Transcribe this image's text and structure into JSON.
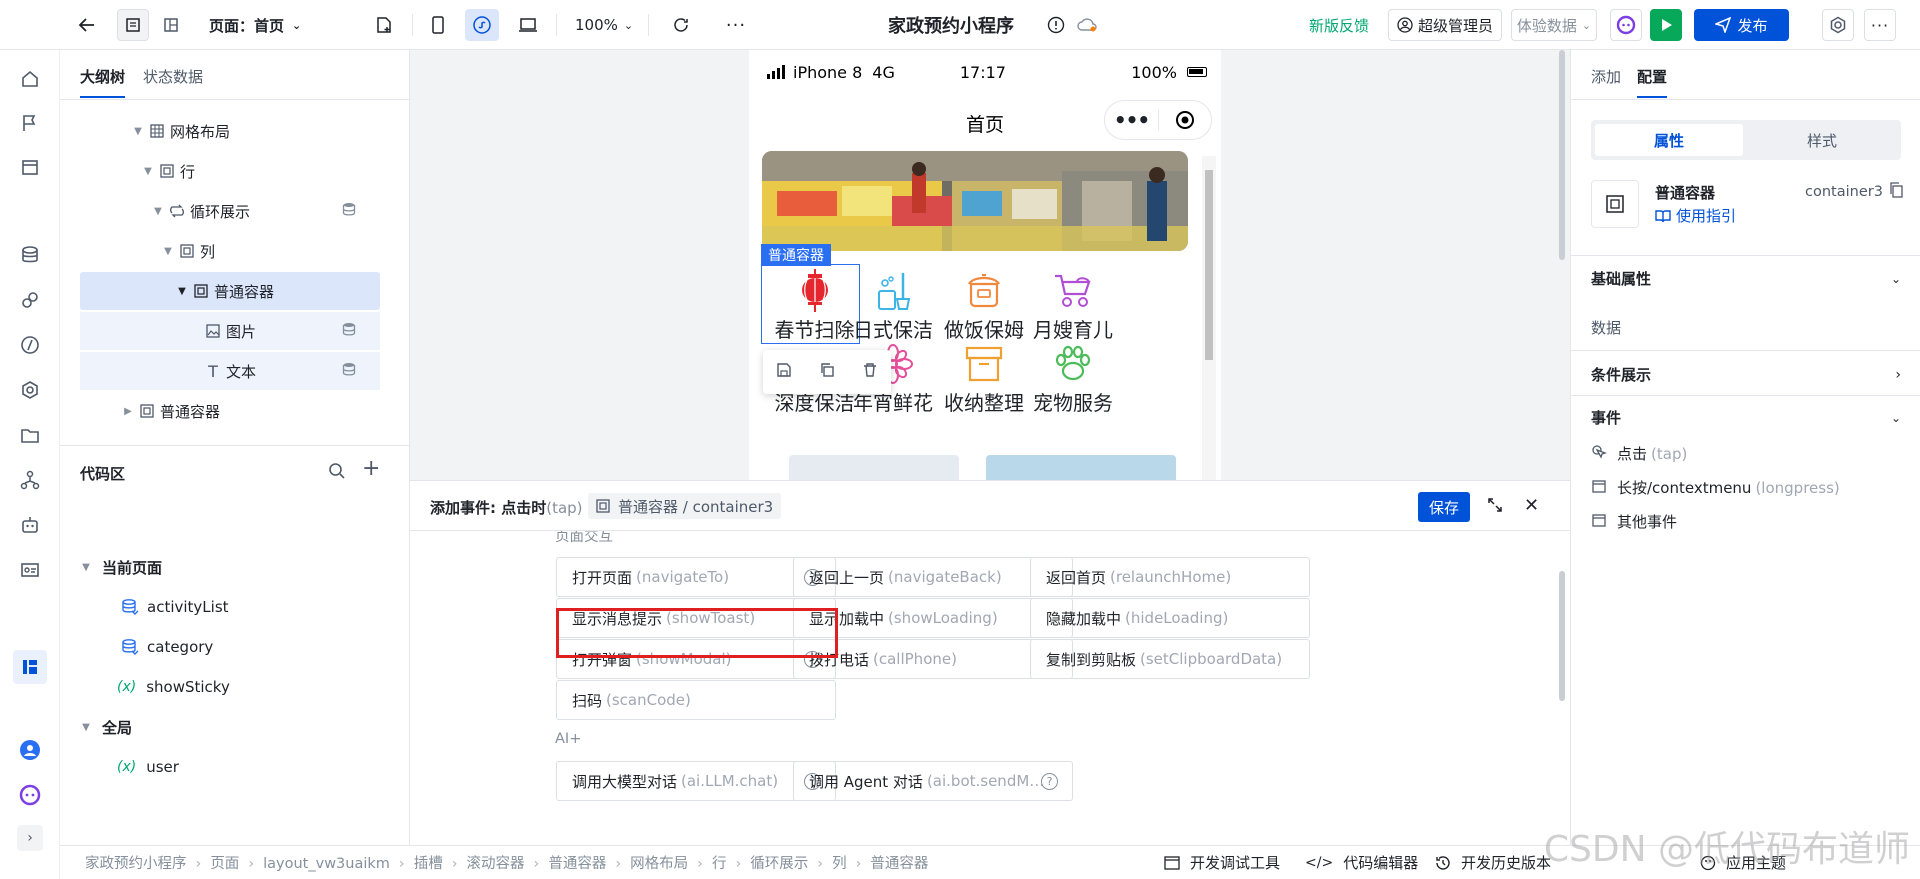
{
  "topbar": {
    "page_label": "页面：首页",
    "zoom": "100%",
    "app_title": "家政预约小程序",
    "feedback": "新版反馈",
    "admin": "超级管理员",
    "env_select": "体验数据",
    "publish": "发布"
  },
  "outline": {
    "tabs": [
      "大纲树",
      "状态数据"
    ],
    "tree": [
      {
        "label": "网格布局"
      },
      {
        "label": "行"
      },
      {
        "label": "循环展示"
      },
      {
        "label": "列"
      },
      {
        "label": "普通容器"
      },
      {
        "label": "图片"
      },
      {
        "label": "文本"
      },
      {
        "label": "普通容器"
      }
    ],
    "code_title": "代码区",
    "current_page": "当前页面",
    "vars": [
      "activityList",
      "category",
      "showSticky"
    ],
    "global": "全局",
    "global_vars": [
      "user"
    ],
    "var_prefix": "(x)"
  },
  "phone": {
    "device": "iPhone 8",
    "network": "4G",
    "time": "17:17",
    "battery": "100%",
    "nav_title": "首页",
    "selected_tag": "普通容器",
    "items": [
      {
        "label": "春节扫除",
        "icon": "lantern-icon",
        "color": "#e6262e"
      },
      {
        "label": "日式保洁",
        "icon": "cleaning-icon",
        "color": "#3cb4e6"
      },
      {
        "label": "做饭保姆",
        "icon": "rice-cooker-icon",
        "color": "#f0883e"
      },
      {
        "label": "月嫂育儿",
        "icon": "stroller-icon",
        "color": "#b04fd6"
      },
      {
        "label": "深度保洁",
        "icon": "deep-clean-icon",
        "color": "#3c8fe6"
      },
      {
        "label": "年宵鲜花",
        "icon": "flower-icon",
        "color": "#e64f9a"
      },
      {
        "label": "收纳整理",
        "icon": "box-icon",
        "color": "#f0a030"
      },
      {
        "label": "宠物服务",
        "icon": "paw-icon",
        "color": "#4cbb5a"
      }
    ]
  },
  "rpanel": {
    "tabs": [
      "添加",
      "配置"
    ],
    "seg": [
      "属性",
      "样式"
    ],
    "component_name": "普通容器",
    "component_id": "container3",
    "guide": "使用指引",
    "basic": "基础属性",
    "data_label": "数据",
    "cond": "条件展示",
    "events": "事件",
    "event_items": [
      {
        "label": "点击",
        "code": "(tap)"
      },
      {
        "label": "长按/contextmenu",
        "code": "(longpress)"
      },
      {
        "label": "其他事件",
        "code": ""
      }
    ]
  },
  "dialog": {
    "title": "添加事件: 点击时",
    "title_code": "(tap)",
    "path": "普通容器 / container3",
    "save": "保存",
    "section1": "页面交互",
    "section2": "AI+",
    "options": [
      {
        "label": "打开页面",
        "code": "(navigateTo)",
        "help": true
      },
      {
        "label": "返回上一页",
        "code": "(navigateBack)",
        "help": false
      },
      {
        "label": "返回首页",
        "code": "(relaunchHome)",
        "help": false
      },
      {
        "label": "显示消息提示",
        "code": "(showToast)",
        "help": false
      },
      {
        "label": "显示加载中",
        "code": "(showLoading)",
        "help": false
      },
      {
        "label": "隐藏加载中",
        "code": "(hideLoading)",
        "help": false
      },
      {
        "label": "打开弹窗",
        "code": "(showModal)",
        "help": true
      },
      {
        "label": "拨打电话",
        "code": "(callPhone)",
        "help": false
      },
      {
        "label": "复制到剪贴板",
        "code": "(setClipboardData)",
        "help": false
      },
      {
        "label": "扫码",
        "code": "(scanCode)",
        "help": false
      }
    ],
    "ai_options": [
      {
        "label": "调用大模型对话",
        "code": "(ai.LLM.chat)",
        "help": true
      },
      {
        "label": "调用 Agent 对话",
        "code": "(ai.bot.sendM…",
        "help": true
      }
    ]
  },
  "bottombar": {
    "breadcrumb": [
      "家政预约小程序",
      "页面",
      "layout_vw3uaikm",
      "插槽",
      "滚动容器",
      "普通容器",
      "网格布局",
      "行",
      "循环展示",
      "列",
      "普通容器"
    ],
    "tools": [
      "开发调试工具",
      "代码编辑器",
      "开发历史版本",
      "应用主题"
    ]
  },
  "watermark": "CSDN @低代码布道师",
  "colors": {
    "primary": "#0052d9",
    "highlight": "#e02020",
    "selection": "#2a6ff2",
    "publish_bg": "#0052d9",
    "run_bg": "#07a85a"
  }
}
